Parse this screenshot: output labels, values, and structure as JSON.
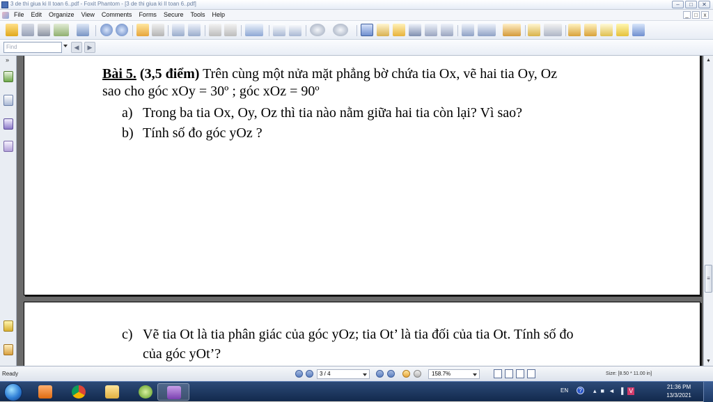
{
  "window": {
    "title": "3 de thi giua ki II toan 6..pdf - Foxit Phantom - [3 de thi giua ki II toan 6..pdf]",
    "min_glyph": "–",
    "max_glyph": "□",
    "close_glyph": "✕"
  },
  "menu": {
    "items": [
      "File",
      "Edit",
      "Organize",
      "View",
      "Comments",
      "Forms",
      "Secure",
      "Tools",
      "Help"
    ],
    "mdi_min": "_",
    "mdi_restore": "□",
    "mdi_close": "x"
  },
  "findbar": {
    "placeholder": "Find",
    "prev_glyph": "◀",
    "next_glyph": "▶"
  },
  "sidepanel": {
    "collapse_glyph": "»"
  },
  "document": {
    "page1": {
      "problem_label": "Bài 5.",
      "points": "(3,5 điểm)",
      "line1_rest": " Trên cùng một nửa mặt phẳng bờ chứa tia Ox, vẽ hai tia Oy, Oz",
      "line2": "sao cho góc xOy = 30º ; góc xOz = 90º",
      "item_a_label": "a)",
      "item_a": "Trong ba tia Ox, Oy, Oz thì tia nào nằm giữa hai tia còn lại? Vì sao?",
      "item_b_label": "b)",
      "item_b": "Tính số đo góc yOz ?"
    },
    "page2": {
      "item_c_label": "c)",
      "item_c_line1": "Vẽ tia Ot là tia phân giác của góc yOz; tia Ot’ là tia đối của tia Ot. Tính số đo",
      "item_c_line2": "của góc yOt’?"
    }
  },
  "status": {
    "ready": "Ready",
    "page": "3 / 4",
    "zoom": "158.7%",
    "size": "Size: [8.50 * 11.00 in]"
  },
  "scrollbar": {
    "up_glyph": "▲",
    "down_glyph": "▼",
    "thumb_glyph": "≡"
  },
  "taskbar": {
    "lang": "EN",
    "help_glyph": "?",
    "tray_glyphs": [
      "▴",
      "■",
      "◄",
      "▐",
      "V"
    ],
    "time": "21:36 PM",
    "date": "13/3/2021"
  },
  "colors": {
    "accent": "#3e5f9e",
    "page_bg": "#ffffff",
    "doc_bg": "#6b6b6b"
  }
}
